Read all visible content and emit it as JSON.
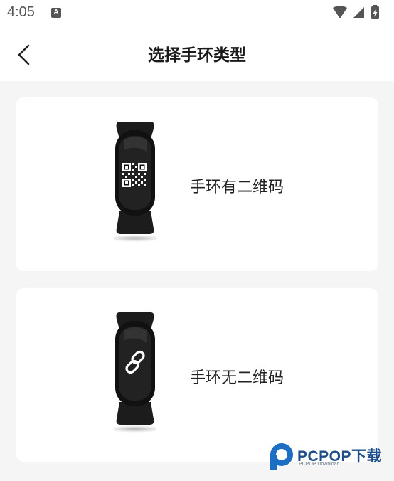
{
  "status_bar": {
    "time": "4:05",
    "notification_glyph": "A"
  },
  "header": {
    "title": "选择手环类型"
  },
  "options": [
    {
      "label": "手环有二维码",
      "icon": "qr-code-icon"
    },
    {
      "label": "手环无二维码",
      "icon": "link-icon"
    }
  ],
  "watermark": {
    "brand": "PCPOP下载",
    "sub": "PCPOP Download"
  },
  "colors": {
    "background": "#f5f5f5",
    "card": "#ffffff",
    "text": "#222222",
    "band": "#1a1a1a",
    "watermark": "#1d4e89"
  }
}
